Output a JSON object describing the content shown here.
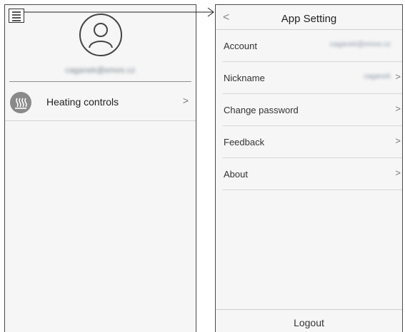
{
  "left_panel": {
    "user_email": "caganek@emos.cz",
    "menu_items": [
      {
        "label": "Heating controls",
        "icon": "heating-icon",
        "chevron": ">"
      }
    ]
  },
  "right_panel": {
    "back": "<",
    "title": "App Setting",
    "rows": [
      {
        "label": "Account",
        "value": "caganek@emos.cz",
        "chevron": ""
      },
      {
        "label": "Nickname",
        "value": "caganek",
        "chevron": ">"
      },
      {
        "label": "Change password",
        "value": "",
        "chevron": ">"
      },
      {
        "label": "Feedback",
        "value": "",
        "chevron": ">"
      },
      {
        "label": "About",
        "value": "",
        "chevron": ">"
      }
    ],
    "logout_label": "Logout"
  }
}
